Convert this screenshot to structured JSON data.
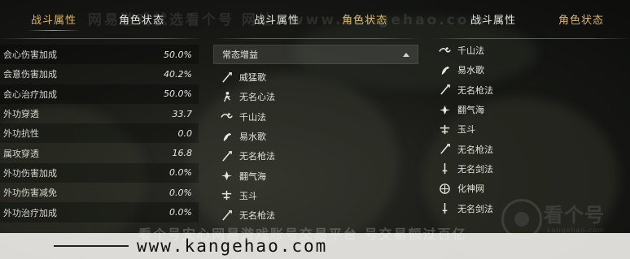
{
  "left_tabs": {
    "active": "战斗属性",
    "other": "角色状态"
  },
  "mid_tabs": {
    "first": "战斗属性",
    "boxed": "角色状态"
  },
  "right_tabs": {
    "first": "战斗属性",
    "boxed": "角色状态"
  },
  "watermark": {
    "top": "网易游戏就选看个号  网址：www.kangehao.com",
    "logo": "看个号",
    "logo_sub": "kangehao.com",
    "banner_url": "www.kangehao.com",
    "banner_under": "看个号安心网易游戏账号交易平台 号交易额过百亿"
  },
  "stats": [
    {
      "label": "会心伤害加成",
      "value": "50.0%"
    },
    {
      "label": "会意伤害加成",
      "value": "40.2%"
    },
    {
      "label": "会心治疗加成",
      "value": "50.0%"
    },
    {
      "label": "外功穿透",
      "value": "33.7"
    },
    {
      "label": "外功抗性",
      "value": "0.0"
    },
    {
      "label": "属攻穿透",
      "value": "16.8"
    },
    {
      "label": "外功伤害加成",
      "value": "0.0%"
    },
    {
      "label": "外功伤害减免",
      "value": "0.0%"
    },
    {
      "label": "外功治疗加成",
      "value": "0.0%"
    }
  ],
  "dropdown": {
    "selected": "常态增益"
  },
  "mid_list": [
    {
      "name": "威猛歌",
      "icon": "spear-icon"
    },
    {
      "name": "无名心法",
      "icon": "figure-icon"
    },
    {
      "name": "千山法",
      "icon": "wave-icon"
    },
    {
      "name": "易水歌",
      "icon": "crane-icon"
    },
    {
      "name": "无名枪法",
      "icon": "spear-icon"
    },
    {
      "name": "翻气海",
      "icon": "lotus-icon"
    },
    {
      "name": "玉斗",
      "icon": "cross-icon"
    },
    {
      "name": "无名枪法",
      "icon": "spear-icon"
    }
  ],
  "right_list": [
    {
      "name": "千山法",
      "icon": "wave-icon"
    },
    {
      "name": "易水歌",
      "icon": "crane-icon"
    },
    {
      "name": "无名枪法",
      "icon": "spear-icon"
    },
    {
      "name": "翻气海",
      "icon": "lotus-icon"
    },
    {
      "name": "玉斗",
      "icon": "cross-icon"
    },
    {
      "name": "无名枪法",
      "icon": "spear-icon"
    },
    {
      "name": "无名剑法",
      "icon": "sword-icon"
    },
    {
      "name": "化神网",
      "icon": "net-icon"
    },
    {
      "name": "无名剑法",
      "icon": "sword-icon"
    }
  ],
  "colors": {
    "accent_gold": "#d9b66a",
    "text": "#d8d6cf"
  }
}
